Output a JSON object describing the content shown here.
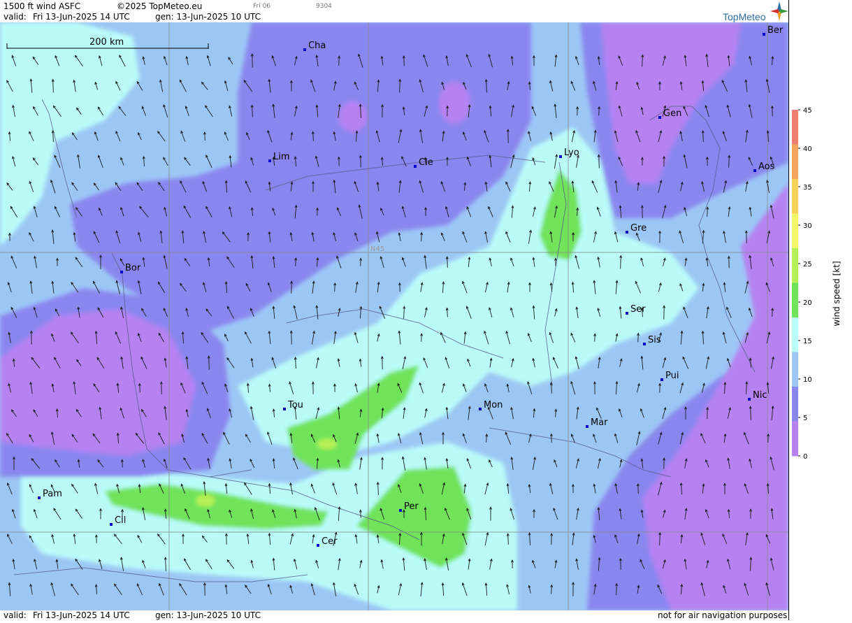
{
  "header": {
    "product": "1500 ft wind ASFC",
    "copyright": "©2025 TopMeteo.eu",
    "day_code": "Fri 06",
    "code": "9304",
    "valid_label": "valid:",
    "valid_time": "Fri  13-Jun-2025  14 UTC",
    "gen_label": "gen: 13-Jun-2025 10 UTC"
  },
  "brand": {
    "name": "TopMeteo",
    "accent": "#2d6fa5"
  },
  "map": {
    "scale_label": "200 km",
    "grid_label": "N45",
    "cities": [
      {
        "label": "Ber"
      },
      {
        "label": "Cha"
      },
      {
        "label": "Gen"
      },
      {
        "label": "Lim"
      },
      {
        "label": "Cle"
      },
      {
        "label": "Lyo"
      },
      {
        "label": "Aos"
      },
      {
        "label": "Gre"
      },
      {
        "label": "Bor"
      },
      {
        "label": "Ser"
      },
      {
        "label": "Sis"
      },
      {
        "label": "Pui"
      },
      {
        "label": "Nic"
      },
      {
        "label": "Tou"
      },
      {
        "label": "Mon"
      },
      {
        "label": "Mar"
      },
      {
        "label": "Pam"
      },
      {
        "label": "Per"
      },
      {
        "label": "Cil"
      },
      {
        "label": "Cer"
      }
    ]
  },
  "legend": {
    "title": "wind  speed  [kt]",
    "ticks": [
      "45",
      "40",
      "35",
      "30",
      "25",
      "20",
      "15",
      "10",
      "5",
      "0"
    ],
    "colors": [
      "#f07f6f",
      "#f7a45e",
      "#f6d25c",
      "#f4f66a",
      "#b6ef57",
      "#6fe35a",
      "#bafbf8",
      "#9cc7f5",
      "#8a86ef",
      "#b682f2"
    ]
  },
  "footer": {
    "valid_label": "valid:",
    "valid_time": "Fri  13-Jun-2025  14 UTC",
    "gen_label": "gen: 13-Jun-2025 10 UTC",
    "disclaimer": "not for air navigation purposes"
  }
}
